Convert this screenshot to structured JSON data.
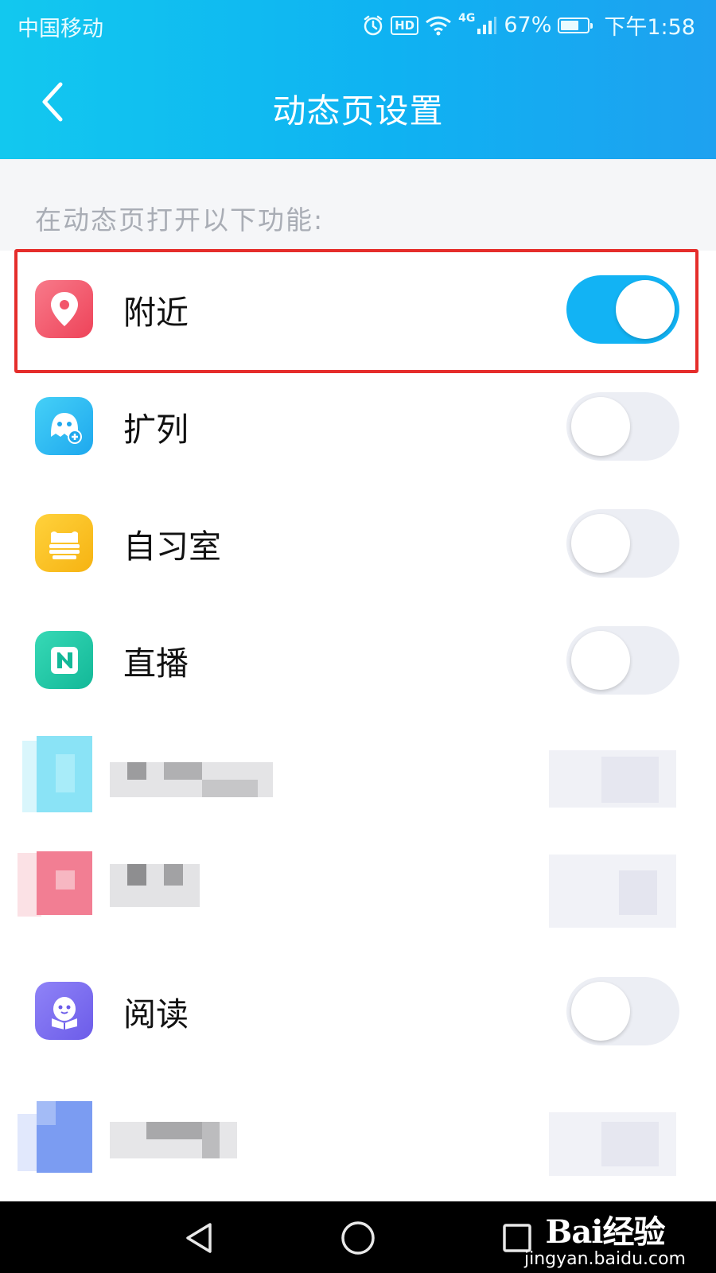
{
  "status_bar": {
    "carrier": "中国移动",
    "network": "4G",
    "battery": "67%",
    "battery_level": 0.67,
    "time": "下午1:58",
    "hd_badge": "HD"
  },
  "nav": {
    "title": "动态页设置",
    "back_icon": "chevron-left-icon"
  },
  "section_label": "在动态页打开以下功能:",
  "colors": {
    "header_start": "#12c8ef",
    "header_end": "#1ea1f0",
    "toggle_on": "#12b3f4",
    "toggle_off": "#eceef4",
    "highlight_border": "#e52d2b"
  },
  "items": [
    {
      "label": "附近",
      "icon": "location-pin-icon",
      "icon_color": "#f2566a",
      "enabled": true
    },
    {
      "label": "扩列",
      "icon": "ghost-add-icon",
      "icon_color": "#2ab4f0",
      "enabled": false
    },
    {
      "label": "自习室",
      "icon": "study-room-icon",
      "icon_color": "#fcc21e",
      "enabled": false
    },
    {
      "label": "直播",
      "icon": "live-icon",
      "icon_color": "#22c9a6",
      "enabled": false
    },
    {
      "label": "",
      "icon": "blurred-icon",
      "icon_color": "#7de0f5",
      "enabled": false,
      "blurred": true
    },
    {
      "label": "",
      "icon": "blurred-icon",
      "icon_color": "#f36a84",
      "enabled": false,
      "blurred": true
    },
    {
      "label": "阅读",
      "icon": "reading-penguin-icon",
      "icon_color": "#7a6cf3",
      "enabled": false
    },
    {
      "label": "",
      "icon": "blurred-icon",
      "icon_color": "#6c8ff1",
      "enabled": false,
      "blurred": true
    }
  ],
  "watermark": {
    "brand": "Bai经验",
    "url": "jingyan.baidu.com"
  },
  "system_nav": {
    "back": "triangle-back-icon",
    "home": "circle-home-icon",
    "recents": "square-recents-icon"
  }
}
